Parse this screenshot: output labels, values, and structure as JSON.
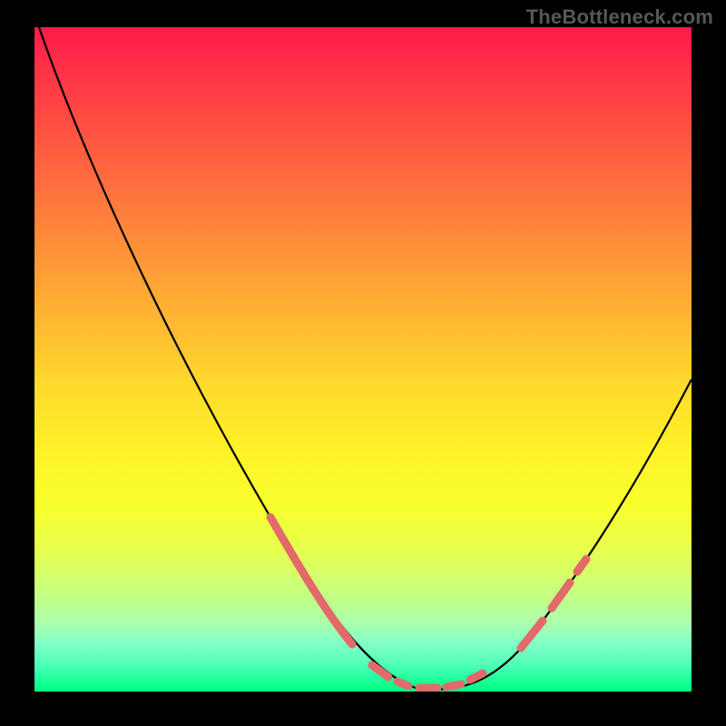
{
  "watermark": "TheBottleneck.com",
  "chart_data": {
    "type": "line",
    "title": "",
    "xlabel": "",
    "ylabel": "",
    "xlim": [
      0,
      100
    ],
    "ylim": [
      0,
      100
    ],
    "series": [
      {
        "name": "bottleneck-curve",
        "x": [
          0,
          5,
          10,
          15,
          20,
          25,
          30,
          35,
          40,
          45,
          50,
          55,
          58,
          60,
          62,
          65,
          68,
          70,
          75,
          80,
          85,
          90,
          95,
          100
        ],
        "values": [
          100,
          92,
          84,
          76,
          68,
          60,
          52,
          43,
          34,
          25,
          16,
          7,
          2,
          0,
          0,
          0,
          2,
          6,
          15,
          24,
          33,
          41,
          48,
          54
        ]
      }
    ],
    "highlight_segments": [
      {
        "x": [
          44,
          54
        ],
        "note": "left valley band"
      },
      {
        "x": [
          56,
          69
        ],
        "note": "valley floor markers"
      },
      {
        "x": [
          70,
          77
        ],
        "note": "right valley band"
      }
    ],
    "background_gradient": {
      "top": "#ff1a4b",
      "mid1": "#ff9a37",
      "mid2": "#ffe82a",
      "bottom": "#00ff7f"
    }
  }
}
